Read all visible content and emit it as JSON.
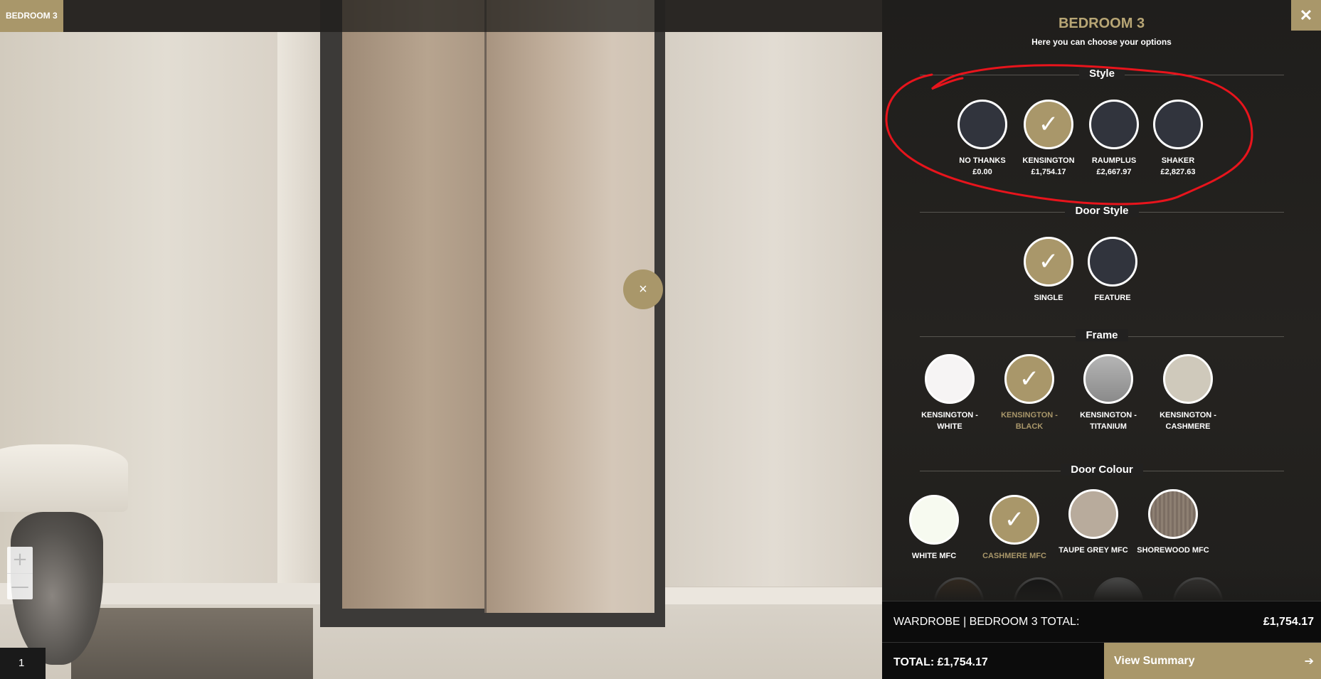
{
  "scene": {
    "badge": "BEDROOM 3",
    "hotspot_icon": "×",
    "zoom_in": "+",
    "zoom_out": "—",
    "page_number": "1"
  },
  "panel": {
    "close_icon": "✕",
    "title": "BEDROOM 3",
    "subtitle": "Here you can choose your options",
    "sections": {
      "style": {
        "heading": "Style",
        "options": [
          {
            "label": "NO THANKS",
            "price": "£0.00",
            "selected": false
          },
          {
            "label": "KENSINGTON",
            "price": "£1,754.17",
            "selected": true
          },
          {
            "label": "RAUMPLUS",
            "price": "£2,667.97",
            "selected": false
          },
          {
            "label": "SHAKER",
            "price": "£2,827.63",
            "selected": false
          }
        ]
      },
      "door_style": {
        "heading": "Door Style",
        "options": [
          {
            "label": "SINGLE",
            "selected": true
          },
          {
            "label": "FEATURE",
            "selected": false
          }
        ]
      },
      "frame": {
        "heading": "Frame",
        "options": [
          {
            "label": "KENSINGTON - WHITE",
            "selected": false,
            "color": "#f6f4f4"
          },
          {
            "label": "KENSINGTON - BLACK",
            "selected": true
          },
          {
            "label": "KENSINGTON - TITANIUM",
            "selected": false,
            "color": "#9a9a9a"
          },
          {
            "label": "KENSINGTON - CASHMERE",
            "selected": false,
            "color": "#cfc9bb"
          }
        ]
      },
      "door_colour": {
        "heading": "Door Colour",
        "options": [
          {
            "label": "WHITE MFC",
            "selected": false,
            "color": "#f7faf0"
          },
          {
            "label": "CASHMERE MFC",
            "selected": true
          },
          {
            "label": "TAUPE GREY MFC",
            "selected": false,
            "color": "#b8ab9c"
          },
          {
            "label": "SHOREWOOD MFC",
            "selected": false,
            "color": "#7c6e63"
          }
        ]
      }
    },
    "footer": {
      "subtotal_label": "WARDROBE | BEDROOM 3 TOTAL:",
      "subtotal_value": "£1,754.17",
      "total_label": "TOTAL: £1,754.17",
      "view_summary": "View Summary",
      "arrow_icon": "➔"
    }
  },
  "colors": {
    "accent": "#a9976a",
    "title_gold": "#b8a675",
    "unselected_circle": "#31343d",
    "annotation": "#e8141c"
  }
}
